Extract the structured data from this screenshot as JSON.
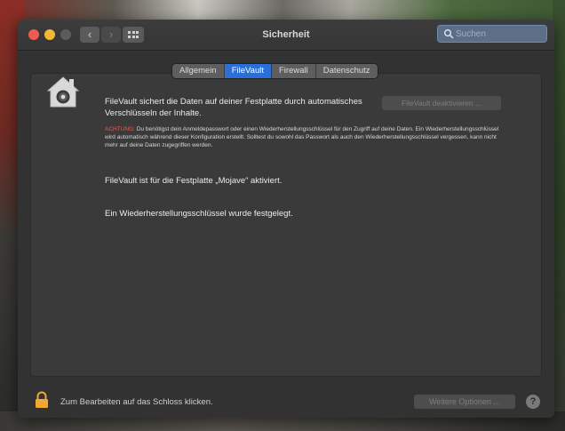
{
  "window": {
    "title": "Sicherheit"
  },
  "toolbar": {
    "back": "‹",
    "forward": "›",
    "search_placeholder": "Suchen"
  },
  "tabs": [
    {
      "label": "Allgemein",
      "active": false
    },
    {
      "label": "FileVault",
      "active": true
    },
    {
      "label": "Firewall",
      "active": false
    },
    {
      "label": "Datenschutz",
      "active": false
    }
  ],
  "filevault": {
    "description": "FileVault sichert die Daten auf deiner Festplatte durch automatisches Verschlüsseln der Inhalte.",
    "disable_button": "FileVault deaktivieren ...",
    "warning_label": "ACHTUNG:",
    "warning_text": " Du benötigst dein Anmeldepasswort oder einen Wiederherstellungsschlüssel für den Zugriff auf deine Daten. Ein Wiederherstellungsschlüssel wird automatisch während dieser Konfiguration erstellt. Solltest du sowohl das Passwort als auch den Wiederherstellungsschlüssel vergessen, kann nicht mehr auf deine Daten zugegriffen werden.",
    "status_enabled": "FileVault ist für die Festplatte „Mojave“ aktiviert.",
    "status_key": "Ein Wiederherstellungsschlüssel wurde festgelegt."
  },
  "footer": {
    "lock_text": "Zum Bearbeiten auf das Schloss klicken.",
    "more_options": "Weitere Optionen ...",
    "help": "?"
  },
  "colors": {
    "accent": "#2c6fd6",
    "warning": "#ee5b52",
    "lock": "#f0a830"
  }
}
